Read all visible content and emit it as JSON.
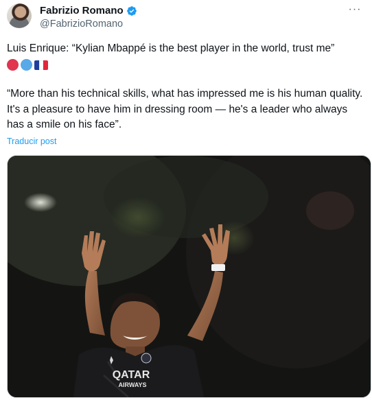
{
  "author": {
    "display_name": "Fabrizio Romano",
    "handle": "@FabrizioRomano",
    "verified": true
  },
  "tweet": {
    "line1": "Luis Enrique: “Kylian Mbappé is the best player in the world, trust me”",
    "emojis": [
      "red-circle",
      "blue-circle",
      "france-flag"
    ],
    "quote": "“More than his technical skills, what has impressed me is his human quality. It's a pleasure to have him in dressing room — he's a leader who always has a smile on his face”.",
    "translate_label": "Traducir post"
  },
  "media": {
    "sponsor_line1": "QATAR",
    "sponsor_line2": "AIRWAYS"
  },
  "colors": {
    "link": "#1d9bf0",
    "verified": "#1d9bf0",
    "red_circle": "#e0344f",
    "blue_circle": "#58a9e8"
  }
}
